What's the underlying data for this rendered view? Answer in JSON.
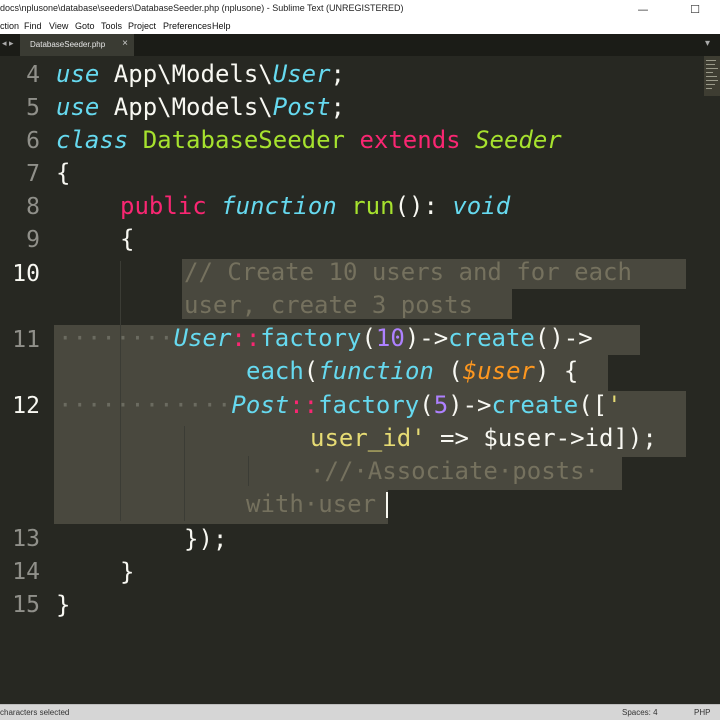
{
  "window": {
    "title": "docs\\nplusone\\database\\seeders\\DatabaseSeeder.php (nplusone) - Sublime Text (UNREGISTERED)",
    "minimize": "—",
    "maximize": "☐",
    "close": "✕"
  },
  "menu": [
    "ction",
    "Find",
    "View",
    "Goto",
    "Tools",
    "Project",
    "Preferences",
    "Help"
  ],
  "tabs": {
    "nav": "◂ ▸",
    "active_tab": "DatabaseSeeder.php",
    "close": "×",
    "dropdown": "▾"
  },
  "editor": {
    "line_numbers": [
      "4",
      "5",
      "6",
      "7",
      "8",
      "9",
      "10",
      "11",
      "12",
      "13",
      "14",
      "15"
    ],
    "lines": {
      "l4": {
        "use": "use",
        "ns": " App\\Models\\",
        "cls": "User",
        "end": ";"
      },
      "l5": {
        "use": "use",
        "ns": " App\\Models\\",
        "cls": "Post",
        "end": ";"
      },
      "l6": {
        "class": "class",
        "name": " DatabaseSeeder",
        "extends": " extends",
        "parent": " Seeder"
      },
      "l7": {
        "brace": "{"
      },
      "l8": {
        "public": "public",
        "function": "function",
        "name": "run",
        "sig": "(): ",
        "ret": "void"
      },
      "l9": {
        "brace": "{"
      },
      "l10a": "// Create 10 users and for each",
      "l10b": "user, create 3 posts",
      "l11a": {
        "ws": "········",
        "cls": "User",
        "op": "::",
        "fn": "factory",
        "p1": "(",
        "num": "10",
        "p2": ")->",
        "fn2": "create",
        "p3": "()->"
      },
      "l11b": {
        "fn": "each",
        "p1": "(",
        "kw": "function",
        "sp": " (",
        "var": "$user",
        "p2": ") {"
      },
      "l12a": {
        "ws": "············",
        "cls": "Post",
        "op": "::",
        "fn": "factory",
        "p1": "(",
        "num": "5",
        "p2": ")->",
        "fn2": "create",
        "p3": "([",
        "str": "'"
      },
      "l12b": {
        "str": "user_id'",
        "op": " => ",
        "var": "$user->id",
        "end": "]);"
      },
      "l12c": "·//·Associate·posts·",
      "l12d": "with·user",
      "l13": "});",
      "l14": "}",
      "l15": "}"
    }
  },
  "status": {
    "left": "characters selected",
    "spaces": "Spaces: 4",
    "syntax": "PHP"
  }
}
